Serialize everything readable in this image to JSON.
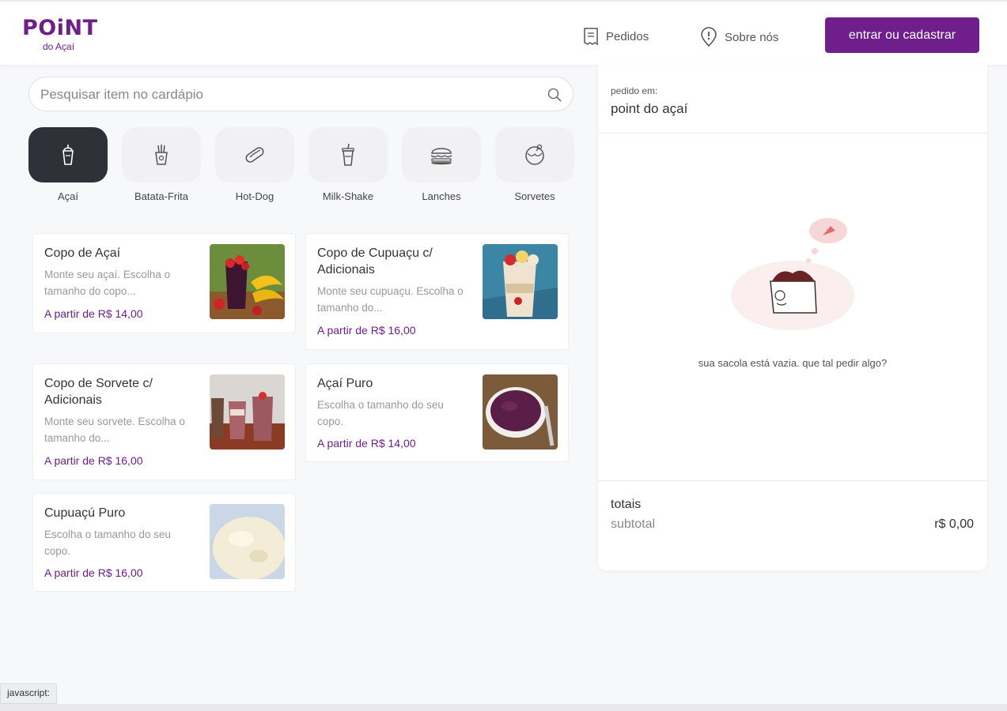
{
  "brand": {
    "name": "POiNT",
    "sub": "do Açaí",
    "color": "#6f1e8c"
  },
  "header": {
    "nav": [
      {
        "label": "Pedidos",
        "icon": "receipt-icon"
      },
      {
        "label": "Sobre nós",
        "icon": "location-pin-icon"
      }
    ],
    "login_label": "entrar ou cadastrar"
  },
  "search": {
    "placeholder": "Pesquisar item no cardápio",
    "icon": "search-icon"
  },
  "categories": [
    {
      "label": "Açaí",
      "icon": "acai-cup-icon",
      "active": true
    },
    {
      "label": "Batata-Frita",
      "icon": "fries-icon",
      "active": false
    },
    {
      "label": "Hot-Dog",
      "icon": "hotdog-icon",
      "active": false
    },
    {
      "label": "Milk-Shake",
      "icon": "milkshake-icon",
      "active": false
    },
    {
      "label": "Lanches",
      "icon": "burger-icon",
      "active": false
    },
    {
      "label": "Sorvetes",
      "icon": "icecream-icon",
      "active": false
    }
  ],
  "products": [
    {
      "name": "Copo de Açaí",
      "desc": "Monte seu açaí. Escolha o tamanho do copo...",
      "price": "A partir de R$ 14,00"
    },
    {
      "name": "Copo de Cupuaçu c/ Adicionais",
      "desc": "Monte seu cupuaçu. Escolha o tamanho do...",
      "price": "A partir de R$ 16,00"
    },
    {
      "name": "Copo de Sorvete c/ Adicionais",
      "desc": "Monte seu sorvete. Escolha o tamanho do...",
      "price": "A partir de R$ 16,00"
    },
    {
      "name": "Açaí Puro",
      "desc": "Escolha o tamanho do seu copo.",
      "price": "A partir de R$ 14,00"
    },
    {
      "name": "Cupuaçú Puro",
      "desc": "Escolha o tamanho do seu copo.",
      "price": "A partir de R$ 16,00"
    }
  ],
  "cart": {
    "ordered_label": "pedido em:",
    "store": "point do açaí",
    "empty_message": "sua sacola está vazia. que tal pedir algo?",
    "totals_title": "totais",
    "subtotal_label": "subtotal",
    "subtotal_value": "r$ 0,00"
  },
  "status_bar": "javascript:"
}
